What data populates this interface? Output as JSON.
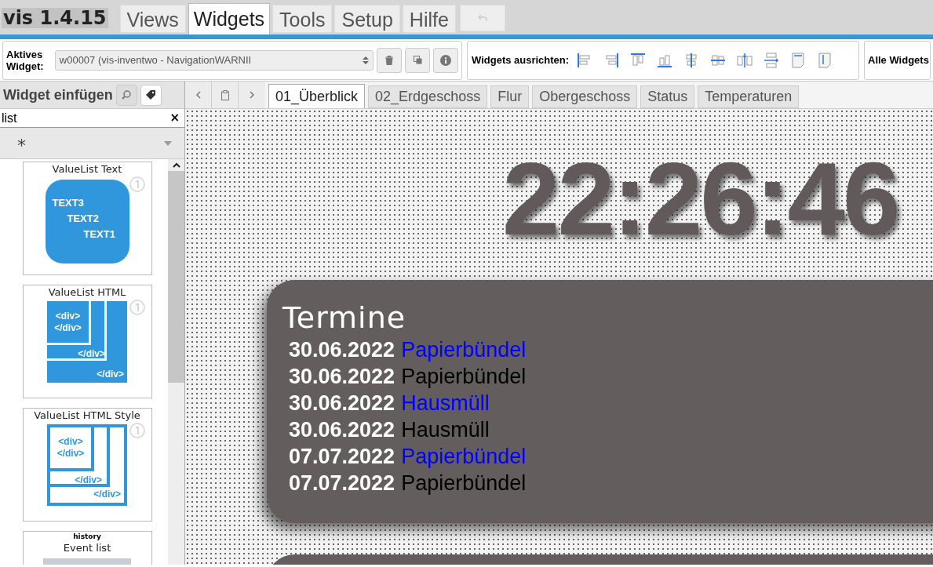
{
  "app_title": "vis 1.4.15",
  "menu_tabs": [
    {
      "label": "Views",
      "selected": false
    },
    {
      "label": "Widgets",
      "selected": true
    },
    {
      "label": "Tools",
      "selected": false
    },
    {
      "label": "Setup",
      "selected": false
    },
    {
      "label": "Hilfe",
      "selected": false
    }
  ],
  "toolbar": {
    "active_widget_label": "Aktives Widget:",
    "active_widget_value": "w00007 (vis-inventwo - NavigationWARNII",
    "align_label": "Widgets ausrichten:",
    "all_widgets_label": "Alle Widgets"
  },
  "sidebar": {
    "title": "Widget einfügen",
    "filter_value": "list",
    "clear_button": "×",
    "set_value": "*",
    "widgets": [
      {
        "kind": "text",
        "title": "ValueList Text",
        "lines": [
          "TEXT3",
          "TEXT2",
          "TEXT1"
        ]
      },
      {
        "kind": "html",
        "title": "ValueList HTML",
        "lines": [
          "<div>",
          "</div>",
          "</div>",
          "</div>"
        ]
      },
      {
        "kind": "htmlstyle",
        "title": "ValueList HTML Style",
        "lines": [
          "<div>",
          "</div>",
          "</div>",
          "</div>"
        ]
      },
      {
        "kind": "event",
        "set": "history",
        "title": "Event list"
      }
    ]
  },
  "view_tabs": [
    {
      "label": "01_Überblick",
      "selected": true
    },
    {
      "label": "02_Erdgeschoss",
      "selected": false
    },
    {
      "label": "Flur",
      "selected": false
    },
    {
      "label": "Obergeschoss",
      "selected": false
    },
    {
      "label": "Status",
      "selected": false
    },
    {
      "label": "Temperaturen",
      "selected": false
    }
  ],
  "canvas": {
    "clock": "22:26:46",
    "card_title": "Termine",
    "events": [
      {
        "date": "30.06.2022",
        "name": "Papierbündel",
        "color": "#0000ff"
      },
      {
        "date": "30.06.2022",
        "name": "Papierbündel",
        "color": "#000000"
      },
      {
        "date": "30.06.2022",
        "name": "Hausmüll",
        "color": "#0000ff"
      },
      {
        "date": "30.06.2022",
        "name": "Hausmüll",
        "color": "#000000"
      },
      {
        "date": "07.07.2022",
        "name": "Papierbündel",
        "color": "#0000ff"
      },
      {
        "date": "07.07.2022",
        "name": "Papierbündel",
        "color": "#000000"
      }
    ]
  }
}
